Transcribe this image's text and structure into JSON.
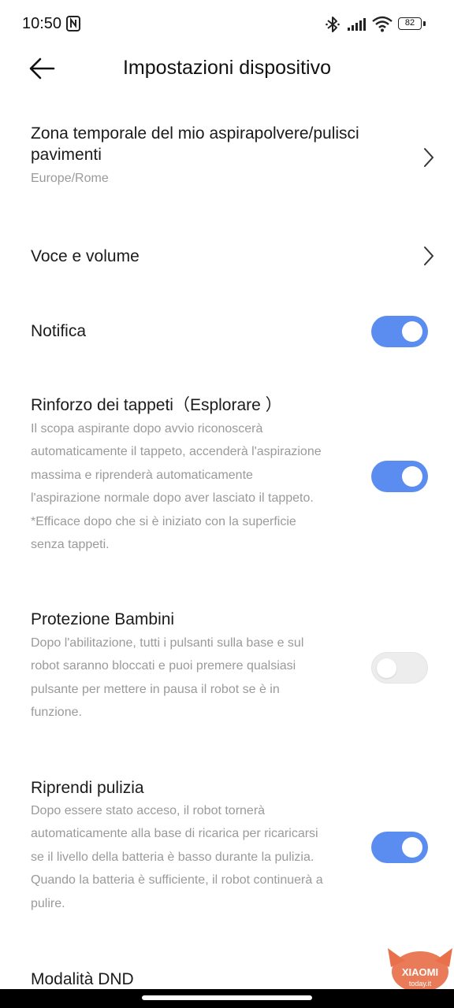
{
  "status_bar": {
    "time": "10:50",
    "battery": "82"
  },
  "header": {
    "title": "Impostazioni dispositivo"
  },
  "settings": {
    "timezone": {
      "title_line1": "Zona temporale del mio aspirapolvere/pulisci",
      "title_line2": "pavimenti",
      "value": "Europe/Rome"
    },
    "voice": {
      "title": "Voce e volume"
    },
    "notification": {
      "title": "Notifica",
      "enabled": true
    },
    "carpet": {
      "title": "Rinforzo dei tappeti（Esplorare ）",
      "lines": [
        "Il scopa aspirante dopo avvio riconoscerà",
        "automaticamente il tappeto, accenderà l'aspirazione",
        "massima e riprenderà automaticamente",
        "l'aspirazione normale dopo aver lasciato il tappeto.",
        "*Efficace dopo che si è iniziato con la superficie",
        "senza tappeti."
      ],
      "enabled": true
    },
    "child_lock": {
      "title": "Protezione Bambini",
      "lines": [
        "Dopo l'abilitazione, tutti i pulsanti sulla base e sul",
        "robot saranno bloccati e puoi premere qualsiasi",
        "pulsante per mettere in pausa il robot se è in",
        "funzione."
      ],
      "enabled": false
    },
    "resume": {
      "title": "Riprendi pulizia",
      "lines": [
        "Dopo essere stato acceso, il robot tornerà",
        "automaticamente alla base di ricarica per ricaricarsi",
        "se il livello della batteria è basso durante la pulizia.",
        "Quando la batteria è sufficiente, il robot continuerà a",
        "pulire."
      ],
      "enabled": true
    },
    "dnd": {
      "title": "Modalità DND"
    }
  },
  "watermark": {
    "brand": "XIAOMI",
    "site": "today.it"
  },
  "colors": {
    "toggle_on": "#5b8df0",
    "toggle_off": "#ededed",
    "subtext": "#9a9a9a",
    "watermark": "#e8704a"
  },
  "icons": [
    "nfc-icon",
    "bluetooth-icon",
    "signal-icon",
    "wifi-icon",
    "battery-icon",
    "back-arrow-icon",
    "chevron-right-icon"
  ]
}
